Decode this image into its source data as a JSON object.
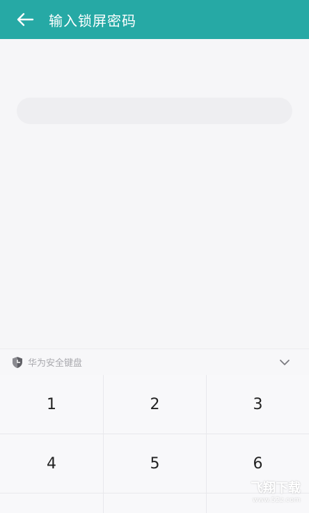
{
  "header": {
    "title": "输入锁屏密码",
    "background": "#26a9a5"
  },
  "password": {
    "value": "",
    "placeholder": ""
  },
  "keyboard": {
    "label": "华为安全键盘",
    "keys": [
      "1",
      "2",
      "3",
      "4",
      "5",
      "6"
    ]
  },
  "watermark": {
    "brand": "飞翔下载",
    "url": "www.52z.com"
  }
}
